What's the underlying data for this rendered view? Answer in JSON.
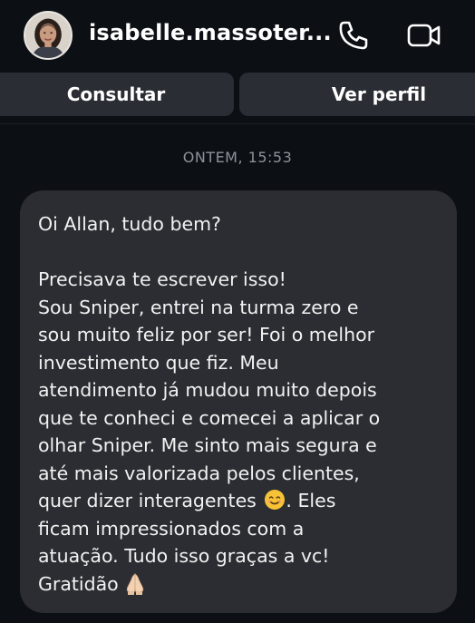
{
  "header": {
    "username": "isabelle.massoter...",
    "avatar_icon": "profile-photo",
    "call_icon": "phone-icon",
    "video_icon": "video-camera-icon"
  },
  "actions": {
    "consult_label": "Consultar",
    "profile_label": "Ver perfil"
  },
  "conversation": {
    "timestamp": "ONTEM, 15:53",
    "message": {
      "greeting": "Oi Allan, tudo bem?",
      "lines": [
        "Precisava te escrever isso!",
        "Sou Sniper, entrei na turma zero e",
        "sou muito feliz por ser! Foi o melhor",
        "investimento que fiz. Meu",
        "atendimento já mudou muito depois",
        "que te conheci e comecei a aplicar o",
        "olhar Sniper. Me sinto mais segura e",
        "até mais valorizada pelos clientes,"
      ],
      "line_with_emoji_before": "quer dizer interagentes",
      "line_with_emoji_after": ". Eles",
      "lines_after": [
        "ficam impressionados com a",
        "atuação. Tudo isso graças a vc!"
      ],
      "closing": "Gratidão",
      "emoji_smile": "smiling-face-emoji",
      "emoji_pray": "folded-hands-emoji"
    }
  },
  "colors": {
    "background": "#0c0f14",
    "bubble": "#2b2d33",
    "button": "#2a2d33",
    "timestamp": "#8e9199"
  }
}
